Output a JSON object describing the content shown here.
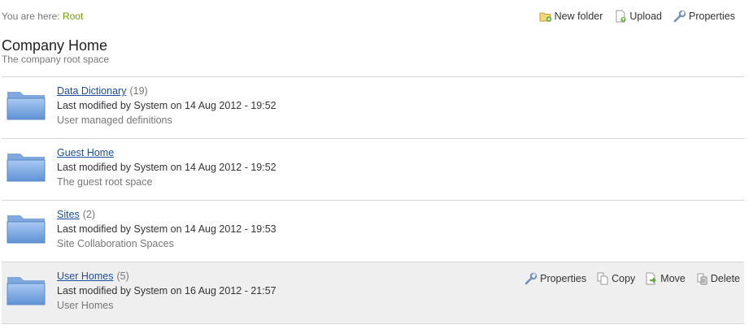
{
  "breadcrumb": {
    "prefix": "You are here:",
    "current": "Root"
  },
  "toolbar": {
    "new_folder": "New folder",
    "upload": "Upload",
    "properties": "Properties"
  },
  "header": {
    "title": "Company Home",
    "subtitle": "The company root space"
  },
  "items": [
    {
      "name": "Data Dictionary",
      "count": "(19)",
      "modified": "Last modified by System on 14 Aug 2012 - 19:52",
      "description": "User managed definitions"
    },
    {
      "name": "Guest Home",
      "count": "",
      "modified": "Last modified by System on 14 Aug 2012 - 19:52",
      "description": "The guest root space"
    },
    {
      "name": "Sites",
      "count": "(2)",
      "modified": "Last modified by System on 14 Aug 2012 - 19:53",
      "description": "Site Collaboration Spaces"
    },
    {
      "name": "User Homes",
      "count": "(5)",
      "modified": "Last modified by System on 16 Aug 2012 - 21:57",
      "description": "User Homes"
    }
  ],
  "row_actions": {
    "properties": "Properties",
    "copy": "Copy",
    "move": "Move",
    "delete": "Delete"
  }
}
